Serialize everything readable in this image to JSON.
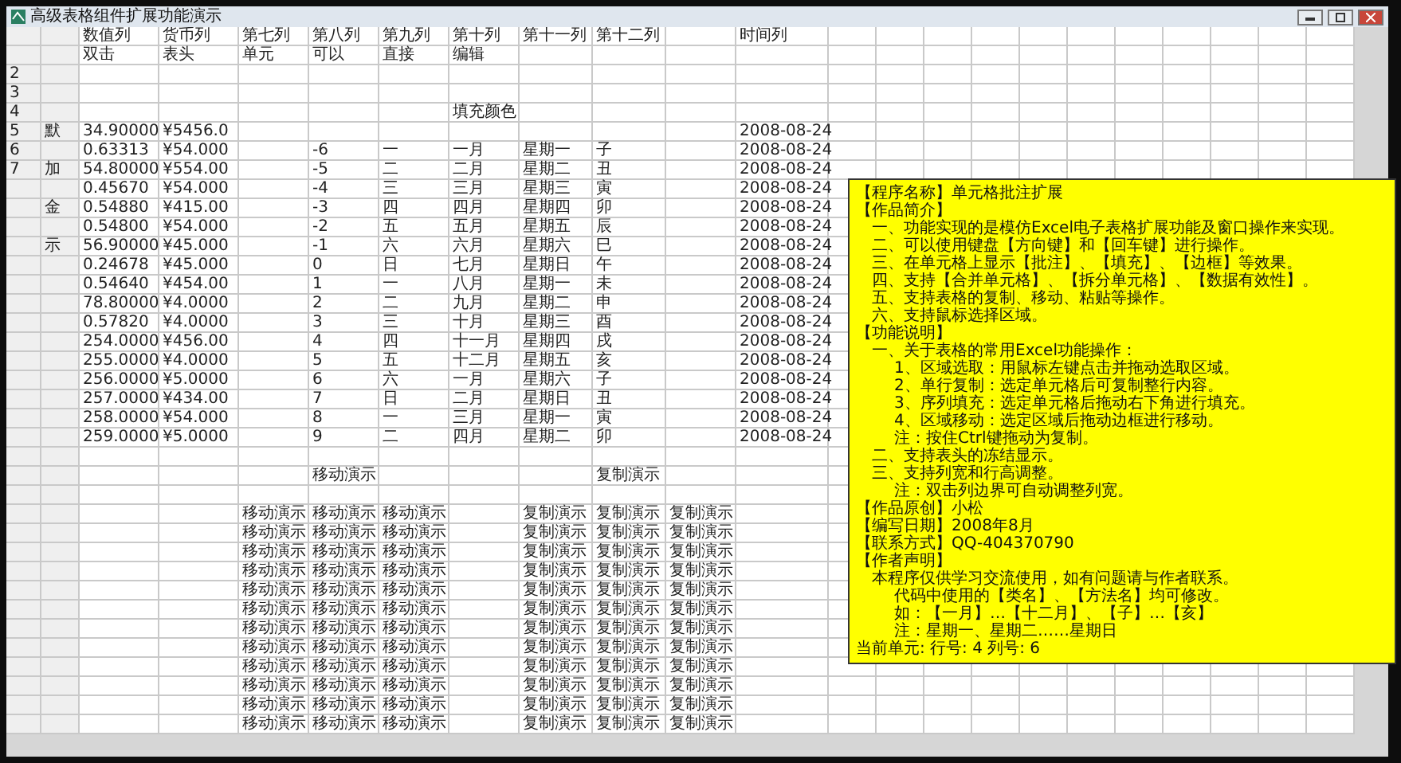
{
  "window": {
    "title": "高级表格组件扩展功能演示"
  },
  "header_rows": [
    {
      "cells": {
        "column_3": "数值列",
        "column_4": "货币列",
        "column_5": "第七列",
        "column_6": "第八列",
        "column_7": "第九列",
        "column_8": "第十列",
        "column_9": "第十一列",
        "column_10": "第十二列",
        "column_12": "时间列"
      }
    },
    {
      "cells": {
        "column_3": "双击",
        "column_4": "表头",
        "column_5": "单元",
        "column_6": "可以",
        "column_7": "直接",
        "column_8": "编辑"
      }
    }
  ],
  "rows": [
    {
      "cells": {
        "column_1": "2"
      }
    },
    {
      "cells": {
        "column_1": "3"
      }
    },
    {
      "cells": {
        "column_1": "4",
        "column_8": "填充颜色"
      }
    },
    {
      "cells": {
        "column_1": "5",
        "column_2": "默",
        "column_3": "34.90000",
        "column_4": "¥5456.0",
        "column_12": "2008-08-24"
      }
    },
    {
      "cells": {
        "column_1": "6",
        "column_3": "0.63313",
        "column_4": "¥54.000",
        "column_6": "-6",
        "column_7": "一",
        "column_8": "一月",
        "column_9": "星期一",
        "column_10": "子",
        "column_12": "2008-08-24"
      }
    },
    {
      "cells": {
        "column_1": "7",
        "column_2": "加",
        "column_3": "54.80000",
        "column_4": "¥554.00",
        "column_6": "-5",
        "column_7": "二",
        "column_8": "二月",
        "column_9": "星期二",
        "column_10": "丑",
        "column_12": "2008-08-24"
      }
    },
    {
      "cells": {
        "column_3": "0.45670",
        "column_4": "¥54.000",
        "column_6": "-4",
        "column_7": "三",
        "column_8": "三月",
        "column_9": "星期三",
        "column_10": "寅",
        "column_12": "2008-08-24"
      }
    },
    {
      "cells": {
        "column_2": "金",
        "column_3": "0.54880",
        "column_4": "¥415.00",
        "column_6": "-3",
        "column_7": "四",
        "column_8": "四月",
        "column_9": "星期四",
        "column_10": "卯",
        "column_12": "2008-08-24"
      }
    },
    {
      "cells": {
        "column_3": "0.54800",
        "column_4": "¥54.000",
        "column_6": "-2",
        "column_7": "五",
        "column_8": "五月",
        "column_9": "星期五",
        "column_10": "辰",
        "column_12": "2008-08-24"
      }
    },
    {
      "cells": {
        "column_2": "示",
        "column_3": "56.90000",
        "column_4": "¥45.000",
        "column_6": "-1",
        "column_7": "六",
        "column_8": "六月",
        "column_9": "星期六",
        "column_10": "巳",
        "column_12": "2008-08-24"
      }
    },
    {
      "cells": {
        "column_3": "0.24678",
        "column_4": "¥45.000",
        "column_6": "0",
        "column_7": "日",
        "column_8": "七月",
        "column_9": "星期日",
        "column_10": "午",
        "column_12": "2008-08-24"
      }
    },
    {
      "cells": {
        "column_3": "0.54640",
        "column_4": "¥454.00",
        "column_6": "1",
        "column_7": "一",
        "column_8": "八月",
        "column_9": "星期一",
        "column_10": "未",
        "column_12": "2008-08-24"
      }
    },
    {
      "cells": {
        "column_3": "78.80000",
        "column_4": "¥4.0000",
        "column_6": "2",
        "column_7": "二",
        "column_8": "九月",
        "column_9": "星期二",
        "column_10": "申",
        "column_12": "2008-08-24"
      }
    },
    {
      "cells": {
        "column_3": "0.57820",
        "column_4": "¥4.0000",
        "column_6": "3",
        "column_7": "三",
        "column_8": "十月",
        "column_9": "星期三",
        "column_10": "酉",
        "column_12": "2008-08-24"
      }
    },
    {
      "cells": {
        "column_3": "254.0000",
        "column_4": "¥456.00",
        "column_6": "4",
        "column_7": "四",
        "column_8": "十一月",
        "column_9": "星期四",
        "column_10": "戌",
        "column_12": "2008-08-24"
      }
    },
    {
      "cells": {
        "column_3": "255.0000",
        "column_4": "¥4.0000",
        "column_6": "5",
        "column_7": "五",
        "column_8": "十二月",
        "column_9": "星期五",
        "column_10": "亥",
        "column_12": "2008-08-24"
      }
    },
    {
      "cells": {
        "column_3": "256.0000",
        "column_4": "¥5.0000",
        "column_6": "6",
        "column_7": "六",
        "column_8": "一月",
        "column_9": "星期六",
        "column_10": "子",
        "column_12": "2008-08-24"
      }
    },
    {
      "cells": {
        "column_3": "257.0000",
        "column_4": "¥434.00",
        "column_6": "7",
        "column_7": "日",
        "column_8": "二月",
        "column_9": "星期日",
        "column_10": "丑",
        "column_12": "2008-08-24"
      }
    },
    {
      "cells": {
        "column_3": "258.0000",
        "column_4": "¥54.000",
        "column_6": "8",
        "column_7": "一",
        "column_8": "三月",
        "column_9": "星期一",
        "column_10": "寅",
        "column_12": "2008-08-24"
      }
    },
    {
      "cells": {
        "column_3": "259.0000",
        "column_4": "¥5.0000",
        "column_6": "9",
        "column_7": "二",
        "column_8": "四月",
        "column_9": "星期二",
        "column_10": "卯",
        "column_12": "2008-08-24"
      }
    }
  ],
  "demo_title_row": {
    "cells": {
      "column_6": "移动演示",
      "column_10": "复制演示"
    }
  },
  "demo_rows": [
    {
      "cells": {
        "column_5": "移动演示",
        "column_6": "移动演示",
        "column_7": "移动演示",
        "column_9": "复制演示",
        "column_10": "复制演示",
        "column_11": "复制演示"
      }
    },
    {
      "cells": {
        "column_5": "移动演示",
        "column_6": "移动演示",
        "column_7": "移动演示",
        "column_9": "复制演示",
        "column_10": "复制演示",
        "column_11": "复制演示"
      }
    },
    {
      "cells": {
        "column_5": "移动演示",
        "column_6": "移动演示",
        "column_7": "移动演示",
        "column_9": "复制演示",
        "column_10": "复制演示",
        "column_11": "复制演示"
      }
    },
    {
      "cells": {
        "column_5": "移动演示",
        "column_6": "移动演示",
        "column_7": "移动演示",
        "column_9": "复制演示",
        "column_10": "复制演示",
        "column_11": "复制演示"
      }
    },
    {
      "cells": {
        "column_5": "移动演示",
        "column_6": "移动演示",
        "column_7": "移动演示",
        "column_9": "复制演示",
        "column_10": "复制演示",
        "column_11": "复制演示"
      }
    },
    {
      "cells": {
        "column_5": "移动演示",
        "column_6": "移动演示",
        "column_7": "移动演示",
        "column_9": "复制演示",
        "column_10": "复制演示",
        "column_11": "复制演示"
      }
    },
    {
      "cells": {
        "column_5": "移动演示",
        "column_6": "移动演示",
        "column_7": "移动演示",
        "column_9": "复制演示",
        "column_10": "复制演示",
        "column_11": "复制演示"
      }
    },
    {
      "cells": {
        "column_5": "移动演示",
        "column_6": "移动演示",
        "column_7": "移动演示",
        "column_9": "复制演示",
        "column_10": "复制演示",
        "column_11": "复制演示"
      }
    },
    {
      "cells": {
        "column_5": "移动演示",
        "column_6": "移动演示",
        "column_7": "移动演示",
        "column_9": "复制演示",
        "column_10": "复制演示",
        "column_11": "复制演示"
      }
    },
    {
      "cells": {
        "column_5": "移动演示",
        "column_6": "移动演示",
        "column_7": "移动演示",
        "column_9": "复制演示",
        "column_10": "复制演示",
        "column_11": "复制演示"
      }
    },
    {
      "cells": {
        "column_5": "移动演示",
        "column_6": "移动演示",
        "column_7": "移动演示",
        "column_9": "复制演示",
        "column_10": "复制演示",
        "column_11": "复制演示"
      }
    },
    {
      "cells": {
        "column_5": "移动演示",
        "column_6": "移动演示",
        "column_7": "移动演示",
        "column_9": "复制演示",
        "column_10": "复制演示",
        "column_11": "复制演示"
      }
    }
  ],
  "comment": {
    "lines": [
      {
        "kind": "heading",
        "text": "【程序名称】单元格批注扩展"
      },
      {
        "kind": "heading",
        "text": "【作品简介】"
      },
      {
        "kind": "item",
        "text": "一、功能实现的是模仿Excel电子表格扩展功能及窗口操作来实现。"
      },
      {
        "kind": "item",
        "text": "二、可以使用键盘【方向键】和【回车键】进行操作。"
      },
      {
        "kind": "item",
        "text": "三、在单元格上显示【批注】、【填充】、【边框】等效果。"
      },
      {
        "kind": "item",
        "text": "四、支持【合并单元格】、【拆分单元格】、【数据有效性】。"
      },
      {
        "kind": "item",
        "text": "五、支持表格的复制、移动、粘贴等操作。"
      },
      {
        "kind": "item",
        "text": "六、支持鼠标选择区域。"
      },
      {
        "kind": "heading",
        "text": "【功能说明】"
      },
      {
        "kind": "item",
        "text": "一、关于表格的常用Excel功能操作："
      },
      {
        "kind": "sub",
        "text": "1、区域选取：用鼠标左键点击并拖动选取区域。"
      },
      {
        "kind": "sub",
        "text": "2、单行复制：选定单元格后可复制整行内容。"
      },
      {
        "kind": "sub",
        "text": "3、序列填充：选定单元格后拖动右下角进行填充。"
      },
      {
        "kind": "sub",
        "text": "4、区域移动：选定区域后拖动边框进行移动。"
      },
      {
        "kind": "sub",
        "text": "注：按住Ctrl键拖动为复制。"
      },
      {
        "kind": "item",
        "text": "二、支持表头的冻结显示。"
      },
      {
        "kind": "item",
        "text": "三、支持列宽和行高调整。"
      },
      {
        "kind": "sub",
        "text": "注：双击列边界可自动调整列宽。"
      },
      {
        "kind": "heading",
        "text": "【作品原创】小松"
      },
      {
        "kind": "heading",
        "text": "【编写日期】2008年8月"
      },
      {
        "kind": "heading",
        "text": "【联系方式】QQ-404370790"
      },
      {
        "kind": "heading",
        "text": "【作者声明】"
      },
      {
        "kind": "item",
        "text": "本程序仅供学习交流使用，如有问题请与作者联系。"
      },
      {
        "kind": "sub",
        "text": "代码中使用的【类名】、【方法名】均可修改。"
      },
      {
        "kind": "sub",
        "text": "如：【一月】…【十二月】、【子】…【亥】"
      },
      {
        "kind": "sub",
        "text": "注：星期一、星期二……星期日"
      },
      {
        "kind": "status",
        "text": "当前单元: 行号: 4 列号: 6"
      }
    ]
  }
}
